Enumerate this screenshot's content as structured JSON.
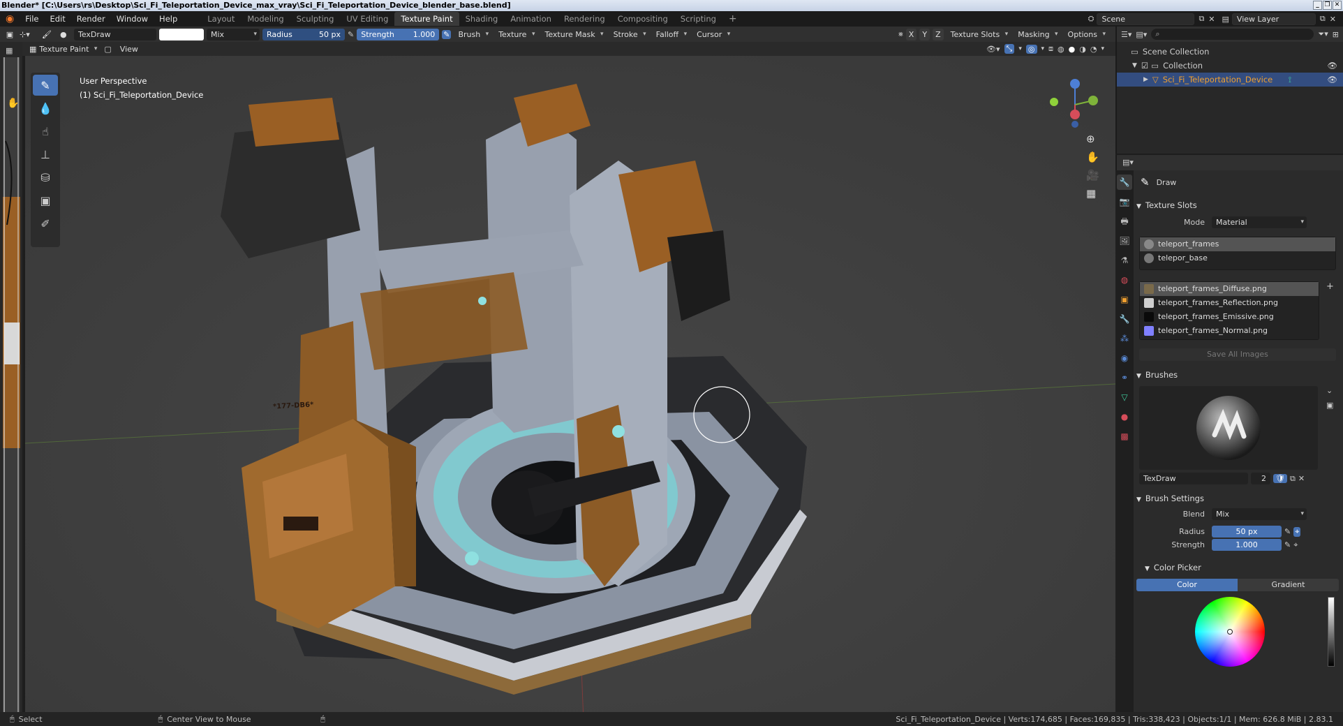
{
  "window": {
    "title": "Blender* [C:\\Users\\rs\\Desktop\\Sci_Fi_Teleportation_Device_max_vray\\Sci_Fi_Teleportation_Device_blender_base.blend]"
  },
  "menu": [
    "File",
    "Edit",
    "Render",
    "Window",
    "Help"
  ],
  "workspaces": [
    "Layout",
    "Modeling",
    "Sculpting",
    "UV Editing",
    "Texture Paint",
    "Shading",
    "Animation",
    "Rendering",
    "Compositing",
    "Scripting"
  ],
  "active_workspace": "Texture Paint",
  "add_workspace": "+",
  "scene": {
    "label": "Scene",
    "view_layer": "View Layer"
  },
  "tool_header": {
    "brush_name": "TexDraw",
    "blend": "Mix",
    "radius_label": "Radius",
    "radius_value": "50 px",
    "strength_label": "Strength",
    "strength_value": "1.000",
    "dropdowns": [
      "Brush",
      "Texture",
      "Texture Mask",
      "Stroke",
      "Falloff",
      "Cursor"
    ],
    "axes": [
      "X",
      "Y",
      "Z"
    ],
    "right_dropdowns": [
      "Texture Slots",
      "Masking",
      "Options"
    ]
  },
  "sub_header": {
    "mode": "Texture Paint",
    "view": "View"
  },
  "viewport": {
    "perspective": "User Perspective",
    "object": "(1) Sci_Fi_Teleportation_Device",
    "crate_label": "*177-DB6*"
  },
  "outliner": {
    "rows": [
      "Scene Collection",
      "Collection",
      "Sci_Fi_Teleportation_Device"
    ]
  },
  "properties": {
    "tool_name": "Draw",
    "texture_slots": {
      "title": "Texture Slots",
      "mode_label": "Mode",
      "mode_value": "Material",
      "materials": [
        "teleport_frames",
        "telepor_base"
      ],
      "images": [
        {
          "name": "teleport_frames_Diffuse.png",
          "color": "#7a6a4a"
        },
        {
          "name": "teleport_frames_Reflection.png",
          "color": "#cfcfcf"
        },
        {
          "name": "teleport_frames_Emissive.png",
          "color": "#0a0a0a"
        },
        {
          "name": "teleport_frames_Normal.png",
          "color": "#8080ff"
        }
      ],
      "save_all": "Save All Images"
    },
    "brushes": {
      "title": "Brushes",
      "brush_name": "TexDraw",
      "users": "2"
    },
    "brush_settings": {
      "title": "Brush Settings",
      "blend_label": "Blend",
      "blend_value": "Mix",
      "radius_label": "Radius",
      "radius_value": "50 px",
      "strength_label": "Strength",
      "strength_value": "1.000"
    },
    "color_picker": {
      "title": "Color Picker",
      "tabs": [
        "Color",
        "Gradient"
      ]
    }
  },
  "statusbar": {
    "left": "Select",
    "middle": "Center View to Mouse",
    "right": "Sci_Fi_Teleportation_Device | Verts:174,685 | Faces:169,835 | Tris:338,423 | Objects:1/1 | Mem: 626.8 MiB | 2.83.1"
  },
  "colors": {
    "accent": "#4772b3",
    "selection": "#334d80",
    "metal": "#8e98a8",
    "orange": "#9a5f24",
    "glow": "#7fd6d6"
  }
}
